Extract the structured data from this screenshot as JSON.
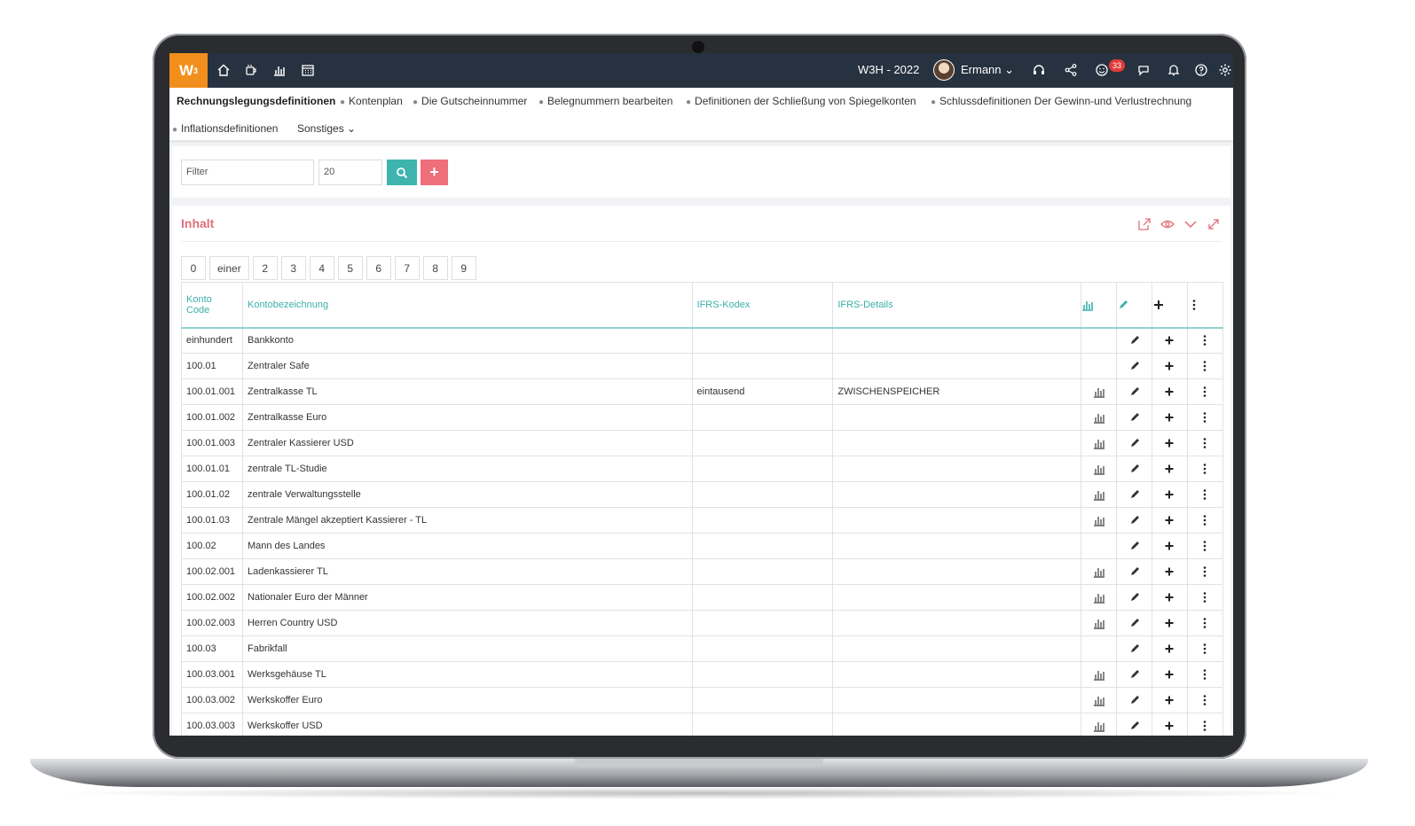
{
  "topbar": {
    "logo": "W",
    "logo_sup": "3",
    "company": "W3H - 2022",
    "user": "Ermann",
    "notification_count": "33",
    "nav_icons": [
      "home-icon",
      "coffee-icon",
      "chart-icon",
      "calendar-icon"
    ],
    "right_icons": [
      "headset-icon",
      "share-icon",
      "smiley-icon",
      "chat-icon",
      "bell-icon",
      "help-icon",
      "gear-icon"
    ]
  },
  "menu": {
    "items": [
      "Rechnungslegungsdefinitionen",
      "Kontenplan",
      "Die Gutscheinnummer",
      "Belegnummern bearbeiten",
      "Definitionen der Schließung von Spiegelkonten",
      "Schlussdefinitionen Der Gewinn-und Verlustrechnung",
      "Inflationsdefinitionen",
      "Sonstiges"
    ]
  },
  "filter": {
    "placeholder": "Filter",
    "count": "20"
  },
  "panel": {
    "title": "Inhalt"
  },
  "pager": [
    "0",
    "einer",
    "2",
    "3",
    "4",
    "5",
    "6",
    "7",
    "8",
    "9"
  ],
  "table": {
    "headers": {
      "code": "Konto Code",
      "name": "Kontobezeichnung",
      "ifrs": "IFRS-Kodex",
      "details": "IFRS-Details"
    },
    "rows": [
      {
        "code": "einhundert",
        "name": "Bankkonto",
        "ifrs": "",
        "details": "",
        "chart": false
      },
      {
        "code": "100.01",
        "name": "Zentraler Safe",
        "ifrs": "",
        "details": "",
        "chart": false
      },
      {
        "code": "100.01.001",
        "name": "Zentralkasse TL",
        "ifrs": "eintausend",
        "details": "ZWISCHENSPEICHER",
        "chart": true
      },
      {
        "code": "100.01.002",
        "name": "Zentralkasse Euro",
        "ifrs": "",
        "details": "",
        "chart": true
      },
      {
        "code": "100.01.003",
        "name": "Zentraler Kassierer USD",
        "ifrs": "",
        "details": "",
        "chart": true
      },
      {
        "code": "100.01.01",
        "name": "zentrale TL-Studie",
        "ifrs": "",
        "details": "",
        "chart": true
      },
      {
        "code": "100.01.02",
        "name": "zentrale Verwaltungsstelle",
        "ifrs": "",
        "details": "",
        "chart": true
      },
      {
        "code": "100.01.03",
        "name": "Zentrale Mängel akzeptiert Kassierer - TL",
        "ifrs": "",
        "details": "",
        "chart": true
      },
      {
        "code": "100.02",
        "name": "Mann des Landes",
        "ifrs": "",
        "details": "",
        "chart": false
      },
      {
        "code": "100.02.001",
        "name": "Ladenkassierer TL",
        "ifrs": "",
        "details": "",
        "chart": true
      },
      {
        "code": "100.02.002",
        "name": "Nationaler Euro der Männer",
        "ifrs": "",
        "details": "",
        "chart": true
      },
      {
        "code": "100.02.003",
        "name": "Herren Country USD",
        "ifrs": "",
        "details": "",
        "chart": true
      },
      {
        "code": "100.03",
        "name": "Fabrikfall",
        "ifrs": "",
        "details": "",
        "chart": false
      },
      {
        "code": "100.03.001",
        "name": "Werksgehäuse TL",
        "ifrs": "",
        "details": "",
        "chart": true
      },
      {
        "code": "100.03.002",
        "name": "Werkskoffer Euro",
        "ifrs": "",
        "details": "",
        "chart": true
      },
      {
        "code": "100.03.003",
        "name": "Werkskoffer USD",
        "ifrs": "",
        "details": "",
        "chart": true
      }
    ]
  },
  "colors": {
    "topbar": "#263240",
    "logo": "#f28f1c",
    "teal": "#3fb3ae",
    "pink": "#ee6e7a",
    "badge": "#e23a3a"
  }
}
